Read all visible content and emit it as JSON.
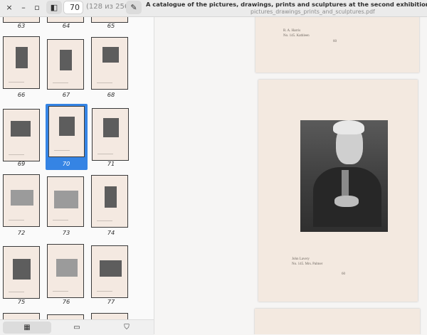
{
  "header": {
    "page_entry_value": "70",
    "page_count": "(128 из 256)",
    "title": "A catalogue of the pictures, drawings, prints and sculptures at the second exhibition of the International Societ",
    "subtitle": "pictures_drawings_prints_and_sculptures.pdf",
    "close_glyph": "×",
    "minimize_glyph": "–",
    "maximize_glyph": "▫",
    "sidebar_glyph": "◧",
    "edit_glyph": "✎"
  },
  "sidebar": {
    "top_labels": [
      "63",
      "64",
      "65"
    ],
    "rows": [
      [
        "66",
        "67",
        "68"
      ],
      [
        "69",
        "70",
        "71"
      ],
      [
        "72",
        "73",
        "74"
      ],
      [
        "75",
        "76",
        "77"
      ]
    ],
    "selected": "70",
    "tabs": [
      {
        "name": "thumbnails",
        "glyph": "▦"
      },
      {
        "name": "annotations",
        "glyph": "▭"
      },
      {
        "name": "bookmarks",
        "glyph": "⛉"
      }
    ]
  },
  "document": {
    "upper_plate": {
      "line1": "R. A. Harris",
      "line2": "No. 145. Kathleen",
      "folio": "60"
    },
    "main_plate": {
      "line1": "John Lavery",
      "line2": "No. 145. Mrs. Palmer",
      "folio": "60"
    }
  },
  "colors": {
    "accent": "#3584e4",
    "page": "#f3e9e0"
  }
}
